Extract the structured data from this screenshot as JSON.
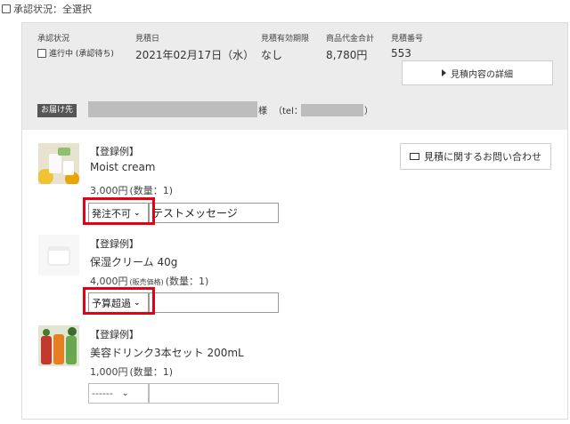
{
  "top": {
    "select_all_label": "承認状況：全選択"
  },
  "estimate": {
    "status_label": "承認状況",
    "status_value": "進行中 (承認待ち)",
    "date_label": "見積日",
    "date_value": "2021年02月17日（水）",
    "validity_label": "見積有効期限",
    "validity_value": "なし",
    "total_label": "商品代金合計",
    "total_value": "8,780円",
    "number_label": "見積番号",
    "number_value": "553",
    "detail_button": "見積内容の詳細",
    "ship_badge": "お届け先",
    "ship_sama": "様",
    "ship_tel": "（tel：",
    "ship_tel_close": "）",
    "inquiry_button": "見積に関するお問い合わせ"
  },
  "items": [
    {
      "tag": "【登録例】",
      "name": "Moist cream",
      "price": "3,000円",
      "price_note": "",
      "qty": "(数量：1)",
      "select_value": "発注不可",
      "message": "テストメッセージ"
    },
    {
      "tag": "【登録例】",
      "name": "保湿クリーム 40g",
      "price": "4,000円",
      "price_note": "(販売価格)",
      "qty": "(数量：1)",
      "select_value": "予算超過",
      "message": ""
    },
    {
      "tag": "【登録例】",
      "name": "美容ドリンク3本セット 200mL",
      "price": "1,000円",
      "price_note": "",
      "qty": "(数量：1)",
      "select_value": "------",
      "message": ""
    }
  ],
  "colors": {
    "highlight": "#e60012",
    "header_bg": "#ececec"
  },
  "icons": [
    "checkbox-icon",
    "triangle-right-icon",
    "mail-icon",
    "chevron-down-icon"
  ]
}
